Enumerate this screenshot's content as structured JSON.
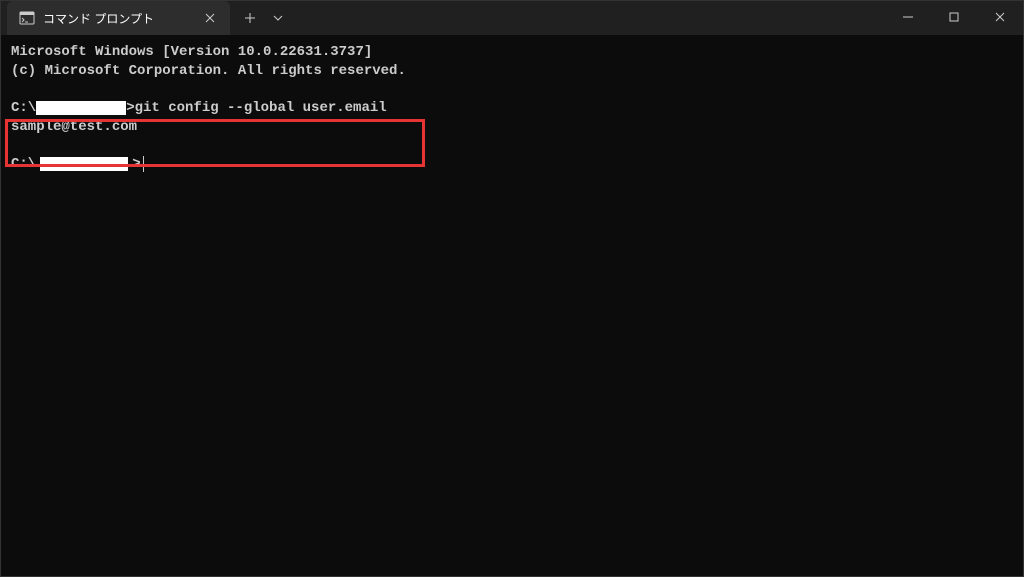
{
  "titlebar": {
    "tab_title": "コマンド プロンプト"
  },
  "terminal": {
    "line1": "Microsoft Windows [Version 10.0.22631.3737]",
    "line2": "(c) Microsoft Corporation. All rights reserved.",
    "prompt1_prefix": "C:\\",
    "prompt1_command": ">git config --global user.email",
    "prompt1_line2": "sample@test.com",
    "prompt2_prefix": "C:\\",
    "prompt2_suffix": ">"
  }
}
